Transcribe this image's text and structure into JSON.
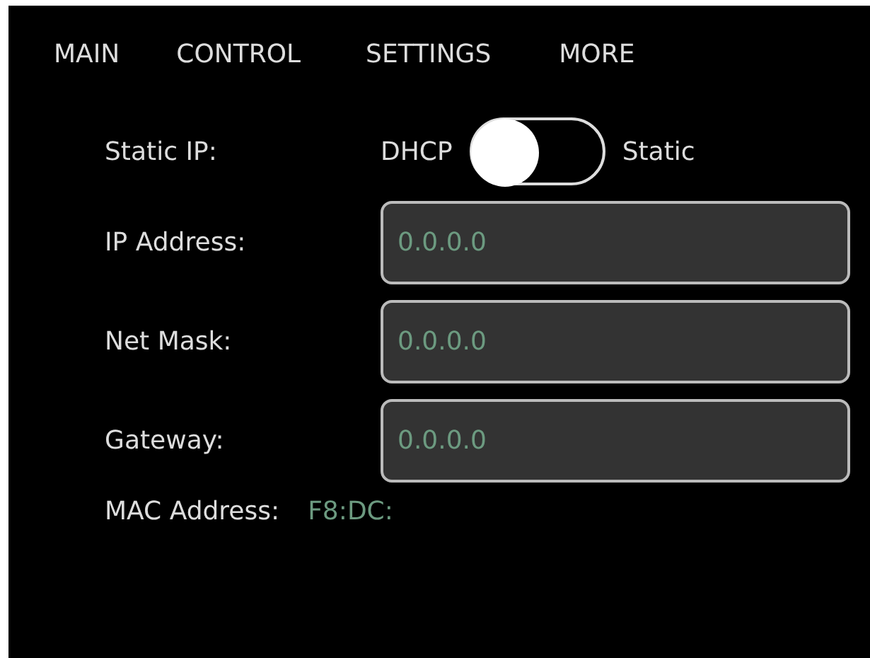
{
  "tabs": [
    {
      "label": "MAIN"
    },
    {
      "label": "CONTROL"
    },
    {
      "label": "SETTINGS"
    },
    {
      "label": "MORE"
    }
  ],
  "static_ip": {
    "label": "Static IP:",
    "off_label": "DHCP",
    "on_label": "Static",
    "on": false
  },
  "fields": [
    {
      "label": "IP Address:",
      "placeholder": "0.0.0.0"
    },
    {
      "label": "Net Mask:",
      "placeholder": "0.0.0.0"
    },
    {
      "label": "Gateway:",
      "placeholder": "0.0.0.0"
    }
  ],
  "mac": {
    "label": "MAC Address:",
    "value": "F8:DC:"
  }
}
